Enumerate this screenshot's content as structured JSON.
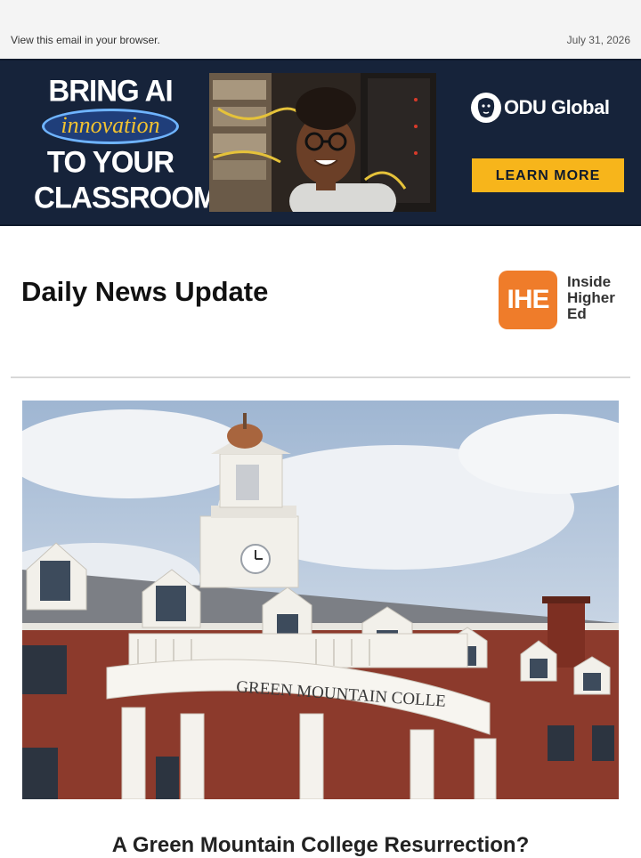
{
  "preheader": {
    "view_link": "View this email in your browser.",
    "date": "July 31, 2026"
  },
  "ad": {
    "headline_line1": "BRING AI",
    "headline_pill": "innovation",
    "headline_line2": "TO YOUR",
    "headline_line3": "CLASSROOM",
    "logo_text": "ODU Global",
    "cta_label": "LEARN MORE",
    "colors": {
      "background": "#16233a",
      "cta": "#f7b51b",
      "pill_text": "#f2c230"
    }
  },
  "masthead": {
    "title": "Daily News Update",
    "logo_mark": "IHE",
    "logo_lines": [
      "Inside",
      "Higher",
      "Ed"
    ],
    "logo_color": "#ef7c2a"
  },
  "hero": {
    "building_sign": "GREEN MOUNTAIN COLLE"
  },
  "article": {
    "headline": "A Green Mountain College Resurrection?"
  }
}
